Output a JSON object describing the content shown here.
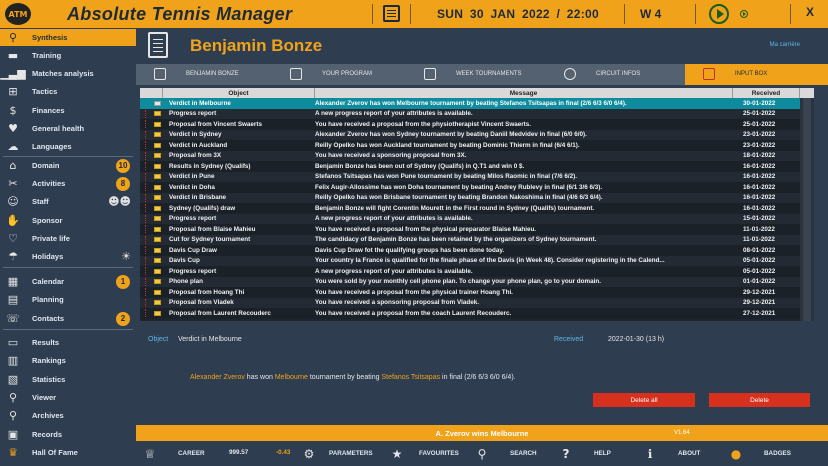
{
  "app": {
    "title": "Absolute Tennis Manager",
    "logo": "ATM"
  },
  "topbar": {
    "date": "SUN  30  JAN  2022 / 22:00",
    "week": "W 4",
    "close": "X"
  },
  "colors": {
    "accent": "#f0a31a",
    "background": "#2e3d50",
    "selection": "#0f8b9e",
    "danger": "#d7301f",
    "link": "#5cb8e8"
  },
  "sidebar": {
    "items": [
      {
        "label": "Synthesis",
        "icon": "magnifier-icon",
        "active": true
      },
      {
        "label": "Training",
        "icon": "dumbbell-icon"
      },
      {
        "label": "Matches analysis",
        "icon": "bar-chart-icon"
      },
      {
        "label": "Tactics",
        "icon": "tactics-icon"
      },
      {
        "label": "Finances",
        "icon": "dollar-icon"
      },
      {
        "label": "General health",
        "icon": "heart-icon"
      },
      {
        "label": "Languages",
        "icon": "chat-icon"
      },
      {
        "label": "Domain",
        "icon": "house-icon",
        "badge": "10"
      },
      {
        "label": "Activities",
        "icon": "tools-icon",
        "badge": "8"
      },
      {
        "label": "Staff",
        "icon": "people-icon"
      },
      {
        "label": "Sponsor",
        "icon": "handshake-icon"
      },
      {
        "label": "Private life",
        "icon": "couple-icon"
      },
      {
        "label": "Holidays",
        "icon": "beach-icon"
      },
      {
        "label": "Calendar",
        "icon": "calendar-icon",
        "badge": "1"
      },
      {
        "label": "Planning",
        "icon": "planning-icon"
      },
      {
        "label": "Contacts",
        "icon": "contacts-icon",
        "badge": "2"
      },
      {
        "label": "Results",
        "icon": "results-icon"
      },
      {
        "label": "Rankings",
        "icon": "rankings-icon"
      },
      {
        "label": "Statistics",
        "icon": "statistics-icon"
      },
      {
        "label": "Viewer",
        "icon": "viewer-icon"
      },
      {
        "label": "Archives",
        "icon": "archives-icon"
      },
      {
        "label": "Records",
        "icon": "records-icon"
      },
      {
        "label": "Hall Of Fame",
        "icon": "trophy-icon"
      }
    ]
  },
  "header": {
    "player_name": "Benjamin Bonze",
    "career_link": "Ma carrière"
  },
  "tabs": [
    {
      "label": "BENJAMIN BONZE",
      "icon": "player-card-icon"
    },
    {
      "label": "YOUR PROGRAM",
      "icon": "program-icon"
    },
    {
      "label": "WEEK TOURNAMENTS",
      "icon": "week-calendar-icon"
    },
    {
      "label": "CIRCUIT INFOS",
      "icon": "info-icon"
    },
    {
      "label": "INPUT BOX",
      "icon": "envelope-icon",
      "active": true
    }
  ],
  "inbox": {
    "columns": [
      "Object",
      "Message",
      "Received"
    ],
    "rows": [
      {
        "object": "Verdict in Melbourne",
        "message": "Alexander Zverov has won Melbourne tournament by beating Stefanos Tsitsapas in final (2/6 6/3 6/0 6/4).",
        "received": "30-01-2022",
        "read": true
      },
      {
        "object": "Progress report",
        "message": "A new progress report of your attributes is available.",
        "received": "25-01-2022"
      },
      {
        "object": "Proposal from Vincent Swaerts",
        "message": "You have received a proposal from the physiotherapist Vincent Swaerts.",
        "received": "25-01-2022"
      },
      {
        "object": "Verdict in Sydney",
        "message": "Alexander Zverov has won Sydney tournament by beating Daniil Medvidev in final (6/0 6/0).",
        "received": "23-01-2022"
      },
      {
        "object": "Verdict in Auckland",
        "message": "Reilly Opelko has won Auckland tournament by beating Dominic Thierm in final (6/4 6/1).",
        "received": "23-01-2022"
      },
      {
        "object": "Proposal from 3X",
        "message": "You have received a sponsoring proposal from 3X.",
        "received": "18-01-2022"
      },
      {
        "object": "Results in Sydney (Qualifs)",
        "message": "Benjamin Bonze has been out of Sydney (Qualifs) in Q.T1 and win 0 $.",
        "received": "16-01-2022"
      },
      {
        "object": "Verdict in Pune",
        "message": "Stefanos Tsitsapas has won Pune tournament by beating Milos Raomic in final (7/6 6/2).",
        "received": "16-01-2022"
      },
      {
        "object": "Verdict in Doha",
        "message": "Felix Augir-Allossime has won Doha tournament by beating Andrey Rublevy in final (6/1 3/6 6/3).",
        "received": "16-01-2022"
      },
      {
        "object": "Verdict in Brisbane",
        "message": "Reilly Opelko has won Brisbane tournament by beating Brandon Nakoshima in final (4/6 6/3 6/4).",
        "received": "16-01-2022"
      },
      {
        "object": "Sydney (Qualifs) draw",
        "message": "Benjamin Bonze will fight Corentin Mourett in the First round in Sydney (Qualifs) tournament.",
        "received": "16-01-2022"
      },
      {
        "object": "Progress report",
        "message": "A new progress report of your attributes is available.",
        "received": "15-01-2022"
      },
      {
        "object": "Proposal from Blaise Mahieu",
        "message": "You have received a proposal from the physical preparator Blaise Mahieu.",
        "received": "11-01-2022"
      },
      {
        "object": "Cut for Sydney tournament",
        "message": "The candidacy of Benjamin Bonze has been retained by the organizers of Sydney tournament.",
        "received": "11-01-2022"
      },
      {
        "object": "Davis Cup Draw",
        "message": "Davis Cup Draw fot the qualifying groups has been done today.",
        "received": "08-01-2022"
      },
      {
        "object": "Davis Cup",
        "message": "Your country la France is qualified for the finale phase of the Davis (in Week 48). Consider registering in the Calend...",
        "received": "05-01-2022"
      },
      {
        "object": "Progress report",
        "message": "A new progress report of your attributes is available.",
        "received": "05-01-2022"
      },
      {
        "object": "Phone plan",
        "message": "You were sold by your monthly cell phone plan. To change your phone plan, go to your domain.",
        "received": "01-01-2022"
      },
      {
        "object": "Proposal from Hoang Thi",
        "message": "You have received a proposal from the physical trainer Hoang Thi.",
        "received": "29-12-2021"
      },
      {
        "object": "Proposal from Vladek",
        "message": "You have received a sponsoring proposal from Vladek.",
        "received": "29-12-2021"
      },
      {
        "object": "Proposal from Laurent Recouderc",
        "message": "You have received a proposal from the coach Laurent Recouderc.",
        "received": "27-12-2021"
      }
    ]
  },
  "detail": {
    "object_label": "Object",
    "object_value": "Verdict in Melbourne",
    "received_label": "Received",
    "received_value": "2022-01-30 (13 h)",
    "msg_p1": "Alexander Zverov",
    "msg_p2": " has won ",
    "msg_p3": "Melbourne",
    "msg_p4": " tournament by beating ",
    "msg_p5": "Stefanos Tsitsapas",
    "msg_p6": " in final (2/6 6/3 6/0 6/4).",
    "delete_all": "Delete all",
    "delete": "Delete"
  },
  "statusbar": {
    "text": "A. Zverov wins Melbourne",
    "version": "V1.64"
  },
  "footer": {
    "career_label": "CAREER",
    "career_value": "999.57",
    "career_delta": "-0.43",
    "parameters": "PARAMETERS",
    "favourites": "FAVOURITES",
    "search": "SEARCH",
    "help": "HELP",
    "about": "ABOUT",
    "badges": "BADGES"
  }
}
